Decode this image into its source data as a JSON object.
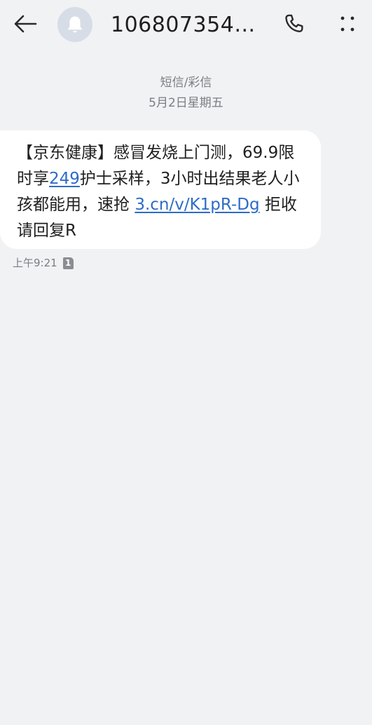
{
  "header": {
    "title": "1068073547...",
    "back_icon": "arrow-left-icon",
    "avatar_icon": "bell-icon",
    "call_icon": "phone-icon",
    "more_icon": "more-vertical-icon"
  },
  "conversation": {
    "message_type": "短信/彩信",
    "date": "5月2日星期五"
  },
  "message": {
    "segment_1": "【京东健康】感冒发烧上门测，69.9限时享",
    "link_1": "249",
    "segment_2": "护士采样，3小时出结果老人小孩都能用，速抢 ",
    "link_2": "3.cn/v/K1pR-Dg",
    "segment_3": " 拒收请回复R",
    "time": "上午9:21",
    "sim": "1",
    "sim_icon": "sim-card-icon"
  },
  "colors": {
    "background": "#f1f2f4",
    "bubble": "#ffffff",
    "link": "#2d6bc9",
    "meta_text": "#7a7d82",
    "avatar": "#d7dde6"
  }
}
